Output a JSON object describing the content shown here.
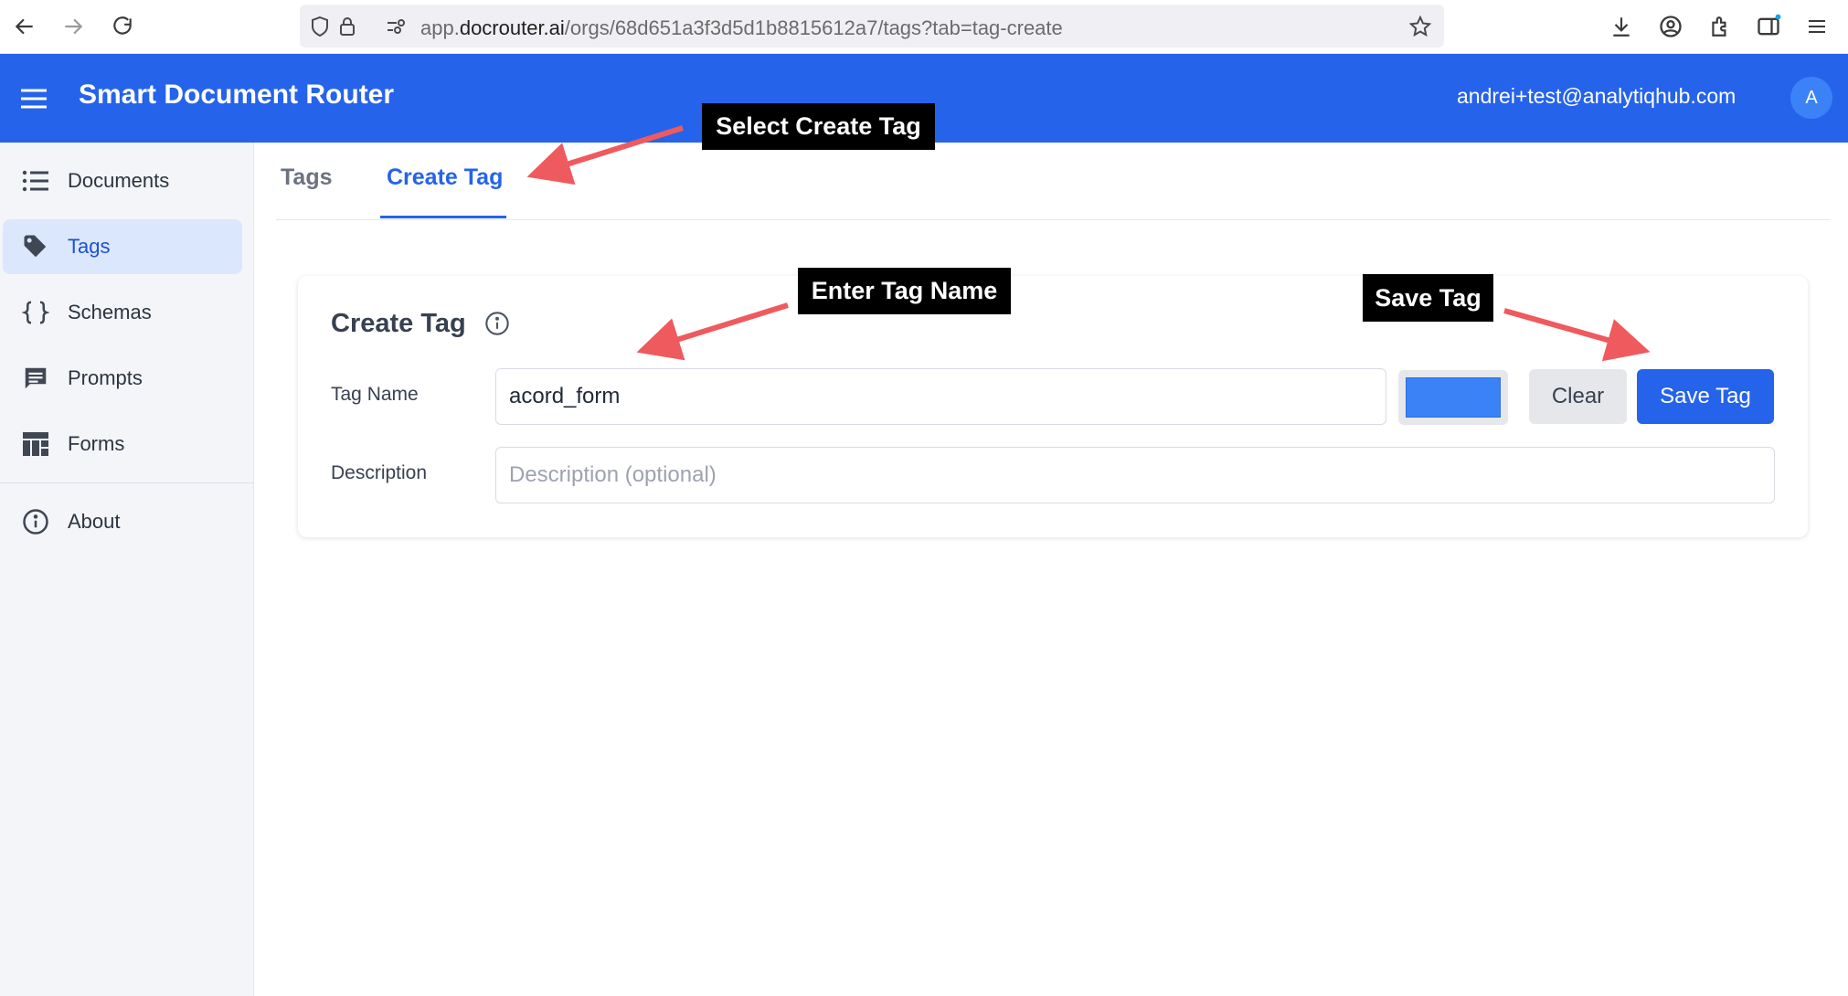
{
  "browser": {
    "url_prefix": "app.",
    "url_domain": "docrouter.ai",
    "url_path": "/orgs/68d651a3f3d5d1b8815612a7/tags?tab=tag-create"
  },
  "header": {
    "app_title": "Smart Document Router",
    "user_email": "andrei+test@analytiqhub.com",
    "avatar_initial": "A"
  },
  "sidebar": {
    "items": [
      {
        "label": "Documents",
        "icon": "list-icon"
      },
      {
        "label": "Tags",
        "icon": "tag-icon",
        "active": true
      },
      {
        "label": "Schemas",
        "icon": "braces-icon"
      },
      {
        "label": "Prompts",
        "icon": "chat-icon"
      },
      {
        "label": "Forms",
        "icon": "dashboard-icon"
      },
      {
        "label": "About",
        "icon": "info-icon"
      }
    ]
  },
  "tabs": {
    "tags": "Tags",
    "create_tag": "Create Tag",
    "active": "create_tag"
  },
  "form": {
    "title": "Create Tag",
    "tag_name_label": "Tag Name",
    "tag_name_value": "acord_form",
    "description_label": "Description",
    "description_placeholder": "Description (optional)",
    "color_value": "#3b82f6",
    "clear_label": "Clear",
    "save_label": "Save Tag"
  },
  "annotations": {
    "select_create_tag": "Select Create Tag",
    "enter_tag_name": "Enter Tag Name",
    "save_tag": "Save Tag"
  },
  "colors": {
    "primary": "#2563eb",
    "arrow": "#ef5a5e"
  }
}
